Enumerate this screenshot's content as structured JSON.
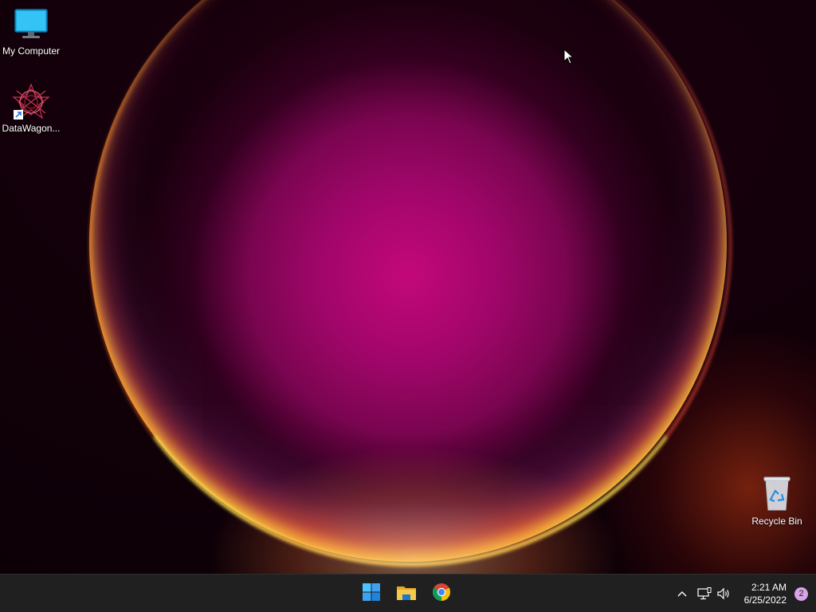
{
  "desktop": {
    "icons": [
      {
        "label": "My Computer",
        "icon": "monitor-icon"
      },
      {
        "label": "DataWagon...",
        "icon": "datawagon-app-icon"
      },
      {
        "label": "Recycle Bin",
        "icon": "recycle-bin-icon"
      }
    ]
  },
  "taskbar": {
    "pinned": [
      {
        "name": "Start",
        "icon": "windows-start-icon"
      },
      {
        "name": "File Explorer",
        "icon": "folder-icon"
      },
      {
        "name": "Google Chrome",
        "icon": "chrome-icon"
      }
    ],
    "tray": {
      "chevron": "chevron-up-icon",
      "network": "network-icon",
      "volume": "volume-icon",
      "time": "2:21 AM",
      "date": "6/25/2022",
      "notification_count": "2"
    }
  },
  "colors": {
    "taskbar_bg": "#202020",
    "start_blue": "#3ea0f0",
    "folder_yellow": "#f7c948",
    "badge": "#d9a5e8"
  }
}
